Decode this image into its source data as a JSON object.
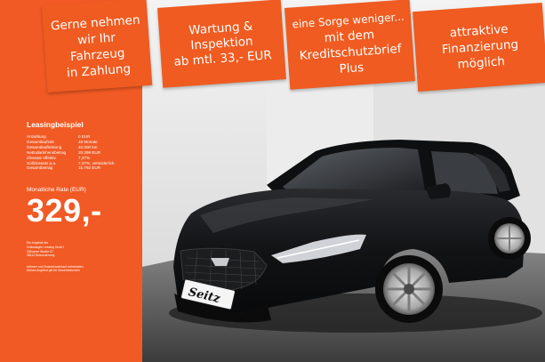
{
  "banners": [
    {
      "lines": [
        "Gerne nehmen",
        "wir Ihr",
        "Fahrzeug",
        "in Zahlung"
      ]
    },
    {
      "lines": [
        "Wartung &",
        "Inspektion",
        "ab mtl. 33,- EUR"
      ]
    },
    {
      "lines": [
        "eine Sorge weniger...",
        "mit dem",
        "Kreditschutzbrief",
        "Plus"
      ]
    },
    {
      "lines": [
        "attraktive",
        "Finanzierung",
        "möglich"
      ]
    }
  ],
  "leasing": {
    "title": "Leasingbeispiel",
    "rows": [
      {
        "label": "Anzahlung",
        "value": "0 EUR"
      },
      {
        "label": "Gesamtlaufzeit",
        "value": "48 Monate"
      },
      {
        "label": "Gesamtlaufleistung",
        "value": "40.000 km"
      },
      {
        "label": "Nettodarlehensbetrag",
        "value": "20.299 EUR"
      },
      {
        "label": "Zinssatz effektiv",
        "value": "7,37%"
      },
      {
        "label": "Sollzinssatz p.a.",
        "value": "7,37%, veränderlich"
      },
      {
        "label": "Gesamtbetrag",
        "value": "15.792 EUR"
      }
    ],
    "rate_label": "Monatliche Rate (EUR)",
    "rate_value": "329,-",
    "lender_lines": [
      "Ein Angebot der",
      "Volkswagen Leasing GmbH",
      "Gifhorner Straße 57",
      "38112 Braunschweig"
    ],
    "disclaimer_lines": [
      "Irrtümer und Zwischenverkauf vorbehalten.",
      "Dieses Angebot gilt für Gewerbekunden"
    ]
  },
  "plate": {
    "text": "Seitz"
  },
  "colors": {
    "orange": "#f15a24",
    "car": "#141517"
  }
}
